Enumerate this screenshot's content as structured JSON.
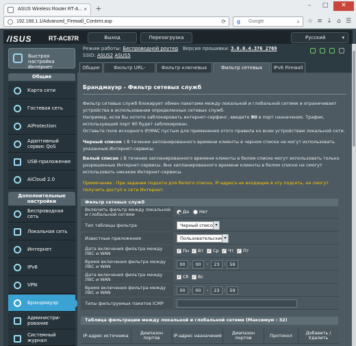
{
  "browser": {
    "tab_title": "ASUS Wireless Router RT-A...",
    "url": "192.168.1.1/Advanced_Firewall_Content.asp",
    "search_placeholder": "Google"
  },
  "header": {
    "logo": "/ISUS",
    "model": "RT-AC87R",
    "logout": "Выход",
    "reboot": "Перезагрузка",
    "language": "Русский"
  },
  "status": {
    "mode_label": "Режим работы:",
    "mode_value": "Беспроводной роутер",
    "fw_label": "Версия прошивки:",
    "fw_value": "3.0.0.4.376_2769",
    "ssid_label": "SSID:",
    "ssid1": "ASUS2",
    "ssid2": "ASUS5"
  },
  "sidebar": {
    "quick_setup": "Быстрая настройка Интернет",
    "group_general": "Общие",
    "general_items": [
      {
        "label": "Карта сети"
      },
      {
        "label": "Гостевая сеть"
      },
      {
        "label": "AiProtection"
      },
      {
        "label": "Адаптивный сервис QoS"
      },
      {
        "label": "USB-приложение"
      },
      {
        "label": "AiCloud 2.0"
      }
    ],
    "group_advanced": "Дополнительные настройки",
    "advanced_items": [
      {
        "label": "Беспроводная сеть"
      },
      {
        "label": "Локальная сеть"
      },
      {
        "label": "Интернет"
      },
      {
        "label": "IPv6"
      },
      {
        "label": "VPN"
      },
      {
        "label": "Брандмауэр"
      },
      {
        "label": "Администри-рование"
      },
      {
        "label": "Системный журнал"
      }
    ]
  },
  "tabs": [
    "Общие",
    "Фильтр URL-адресов",
    "Фильтр ключевых слов",
    "Фильтр сетевых служб",
    "IPv6 Firewall"
  ],
  "page": {
    "title": "Брандмауэр - Фильтр сетевых служб",
    "desc1": "Фильтр сетевых служб блокирует обмен пакетами между локальной и глобальной сетями и ограничивает устройства в использовании определенных сетевых служб.",
    "desc2_a": "Например, если Вы хотите заблокировать интернет-серфинг, введите ",
    "desc2_b": "80",
    "desc2_c": " в порт назначения. Трафик, использующий порт 80 будет заблокирован.",
    "desc3": "Оставьте поле исходного IP/MAC пустым для применения этого правила ко всем устройствам локальной сети.",
    "black_label": "Черный список :",
    "black_text": " В течении запланированного времени клиенты в черном списке не могут использовать указанные Интернет-сервисы.",
    "white_label": "Белый список :",
    "white_text": " В течении запланированного времени клиенты в белом списке могут использовать только разрешенные Интернет-сервисы. Вне запланированного времени клиенты в белом списке не смогут использовать никакие Интернет-сервисы.",
    "note": "Примечание : При задании подсети для белого списка, IP-адреса не входящие в эту подсеть, не смогут получить доступ к сети Интернет."
  },
  "filter_table": {
    "header": "Фильтр сетевых служб",
    "rows": {
      "enable_label": "Включить фильтр между локальной и глобальной сетями",
      "yes": "Да",
      "no": "Нет",
      "type_label": "Тип таблицы фильтра",
      "type_value": "Черный  список",
      "apps_label": "Известные приложения",
      "apps_value": "Пользовательские",
      "date1_label": "Дата включения фильтра между ЛВС и WAN",
      "days1": [
        "Пн",
        "Вт",
        "Ср",
        "Чт",
        "Пт"
      ],
      "time1_label": "Время включения фильтра между ЛВС и WAN",
      "time1": [
        "00",
        "00",
        "23",
        "59"
      ],
      "date2_label": "Дата включения фильтра между ЛВС и WAN",
      "days2": [
        "Сб",
        "Вс"
      ],
      "time2_label": "Время включения фильтра между ЛВС и WAN",
      "time2": [
        "00",
        "00",
        "23",
        "59"
      ],
      "icmp_label": "Типы фильтруемых пакетов ICMP",
      "sep": ":",
      "dash": "-"
    }
  },
  "rules_table": {
    "header": "Таблица фильтрации между локальной и глобальной сетями (Максимум : 32)",
    "columns": [
      "IP-адрес источника",
      "Диапазон портов",
      "IP-адрес назначения",
      "Диапазон портов",
      "Протокол",
      "Добавить / Удалить"
    ]
  }
}
